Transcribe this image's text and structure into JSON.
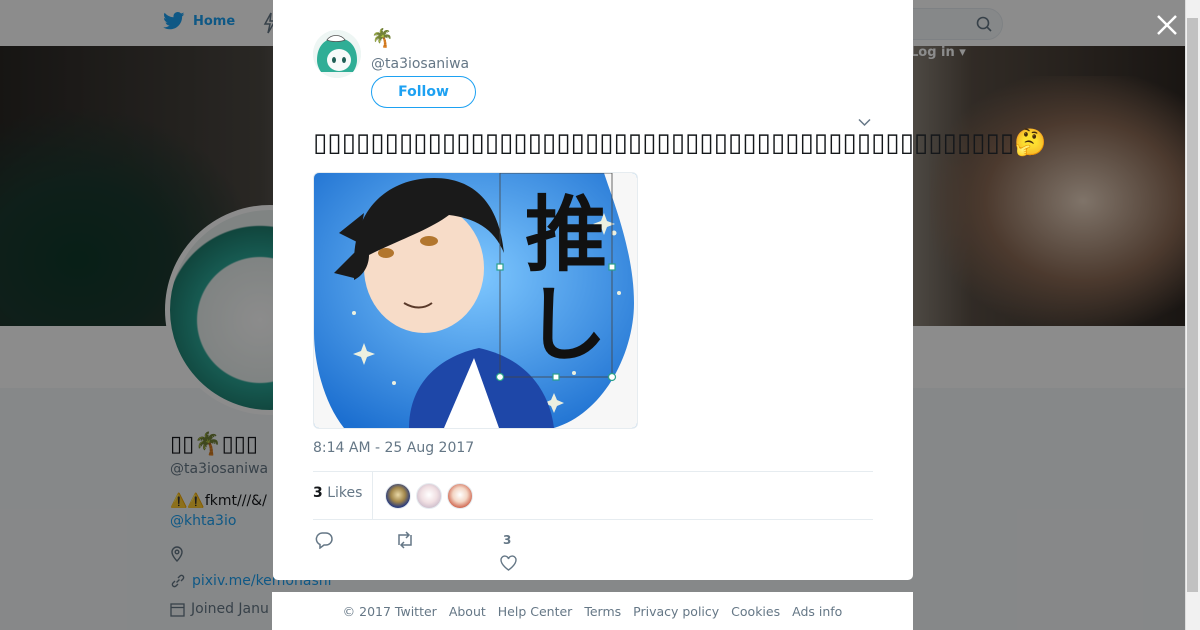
{
  "header": {
    "home_label": "Home",
    "login_label": "Log in"
  },
  "profile": {
    "display_name": "▯▯🌴▯▯▯",
    "handle": "@ta3iosaniwa",
    "bio": "⚠️⚠️fkmt///&/",
    "mention": "@khta3io",
    "link": "pixiv.me/kemohashi",
    "joined": "Joined Janu"
  },
  "tweet": {
    "author_name": "🌴",
    "author_handle": "@ta3iosaniwa",
    "follow_label": "Follow",
    "text": "▯▯▯▯▯▯▯▯▯▯▯▯▯▯▯▯▯▯▯▯▯▯▯▯▯▯▯▯▯▯▯▯▯▯▯▯▯▯▯▯▯▯▯▯▯▯▯▯▯🤔",
    "image_text": "推し",
    "timestamp": "8:14 AM - 25 Aug 2017",
    "likes_count": "3",
    "likes_label": "Likes",
    "like_action_count": "3"
  },
  "footer": {
    "links": [
      "© 2017 Twitter",
      "About",
      "Help Center",
      "Terms",
      "Privacy policy",
      "Cookies",
      "Ads info"
    ]
  },
  "colors": {
    "accent": "#1da1f2",
    "text": "#14171a",
    "muted": "#657786"
  },
  "icons": [
    "twitter-bird-icon",
    "search-icon",
    "close-icon",
    "chevron-down-icon",
    "reply-icon",
    "retweet-icon",
    "heart-icon",
    "location-icon",
    "link-icon",
    "calendar-icon"
  ]
}
